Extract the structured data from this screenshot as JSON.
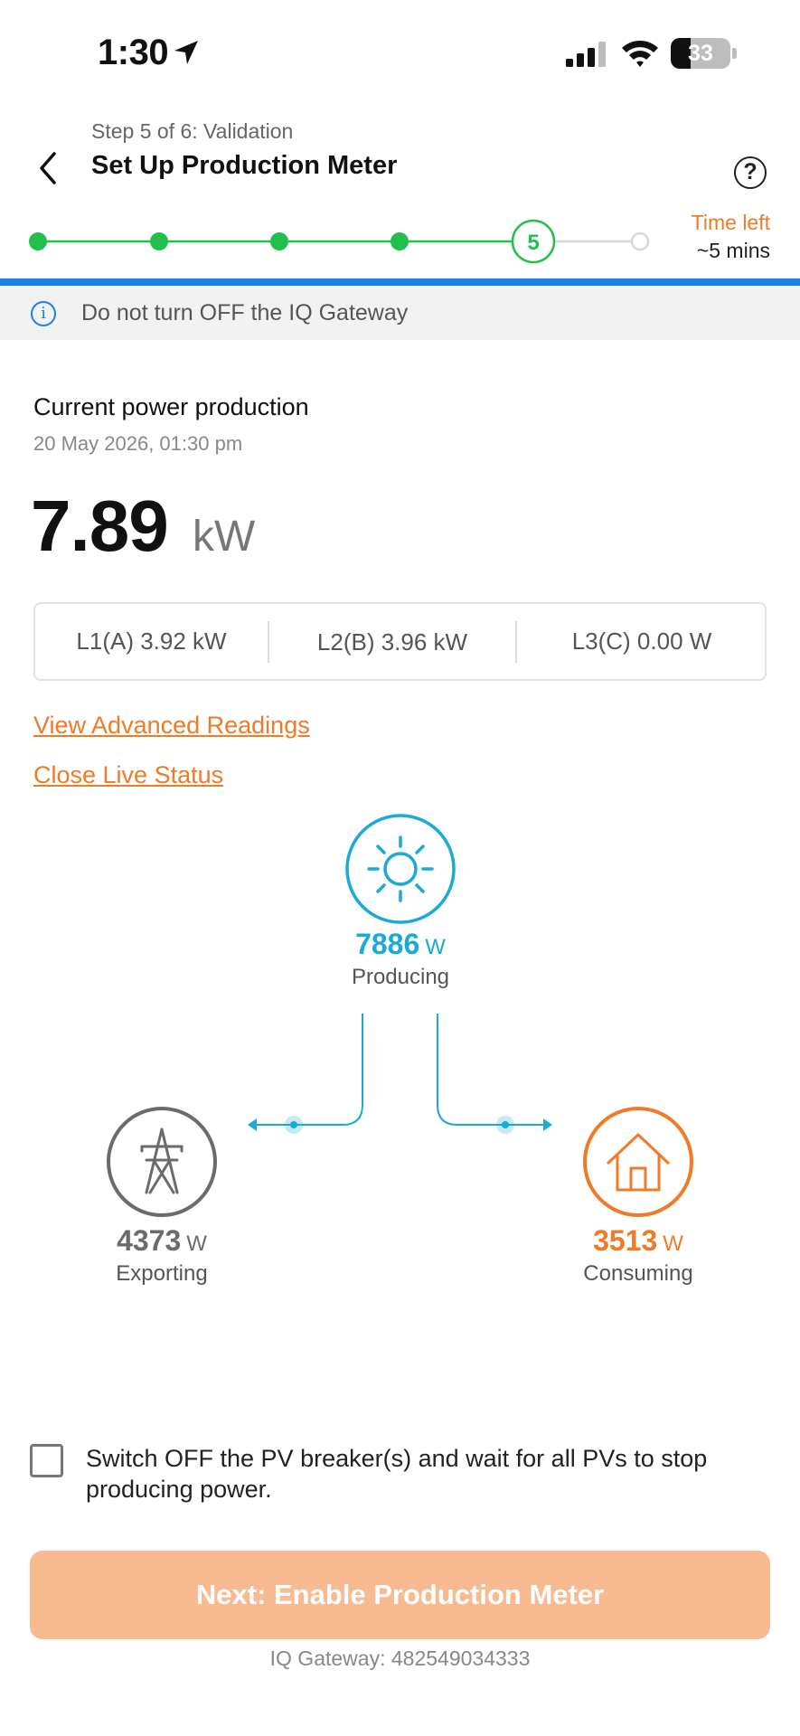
{
  "status_bar": {
    "time": "1:30",
    "battery": "33",
    "icons": [
      "location-arrow-icon",
      "cell-signal-icon",
      "wifi-icon",
      "battery-icon"
    ]
  },
  "header": {
    "step_label": "Step 5 of 6: Validation",
    "title": "Set Up Production Meter",
    "help_icon": "?",
    "back_icon": "chevron-left-icon"
  },
  "progress": {
    "total_steps": 6,
    "current_step": "5",
    "completed_steps": 4,
    "color_done": "#1fc14a",
    "color_pending": "#d8d8d8"
  },
  "time_left": {
    "label": "Time left",
    "value": "~5 mins"
  },
  "banner": {
    "icon": "info-icon",
    "text": "Do not turn OFF the IQ Gateway"
  },
  "production": {
    "title": "Current power production",
    "date": "20 May 2026, 01:30 pm",
    "value": "7.89",
    "unit": "kW",
    "phases": [
      "L1(A) 3.92 kW",
      "L2(B) 3.96 kW",
      "L3(C) 0.00 W"
    ]
  },
  "links": {
    "advanced": "View Advanced Readings",
    "close": "Close Live Status"
  },
  "flow": {
    "solar": {
      "value": "7886",
      "unit": "W",
      "caption": "Producing",
      "color": "#1aaad6",
      "icon": "sun-icon"
    },
    "grid": {
      "value": "4373",
      "unit": "W",
      "caption": "Exporting",
      "color": "#6b6b6b",
      "icon": "transmission-tower-icon"
    },
    "home": {
      "value": "3513",
      "unit": "W",
      "caption": "Consuming",
      "color": "#f07b26",
      "icon": "house-icon"
    }
  },
  "checkbox": {
    "label": "Switch OFF the PV breaker(s) and wait for all PVs to stop producing power."
  },
  "next_button": {
    "label": "Next: Enable Production Meter"
  },
  "gateway": "IQ Gateway: 482549034333",
  "colors": {
    "accent": "#f07b26",
    "blue": "#1a7fe8"
  }
}
